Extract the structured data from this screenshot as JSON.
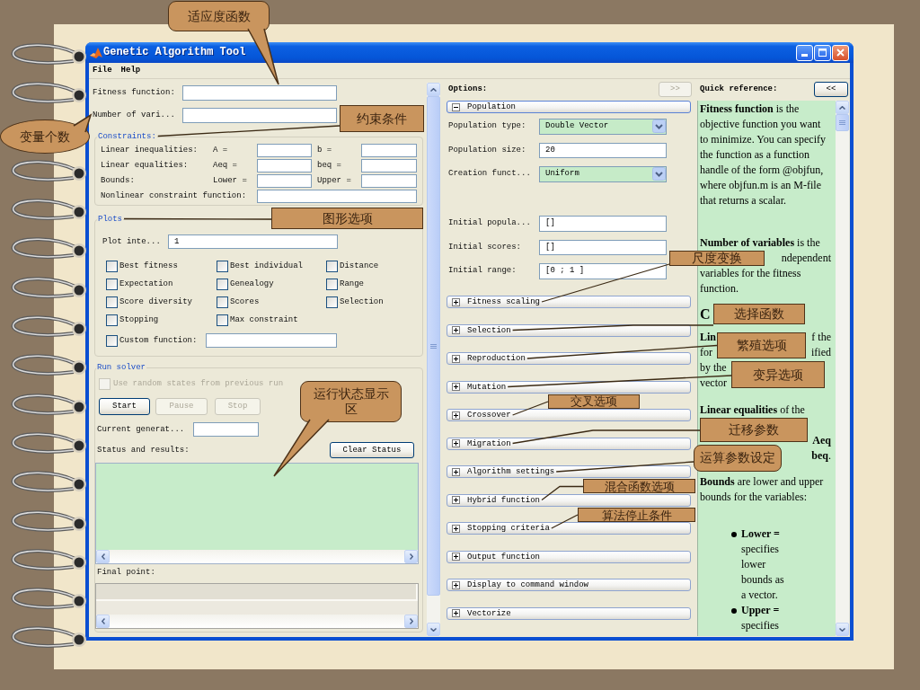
{
  "window": {
    "title": "Genetic Algorithm Tool"
  },
  "menu": [
    {
      "label": "File"
    },
    {
      "label": "Help"
    }
  ],
  "problem": [
    {
      "label": "Fitness function:"
    },
    {
      "label": "Number of vari..."
    }
  ],
  "constraints": {
    "title": "Constraints:",
    "rows": [
      {
        "label": "Linear inequalities:",
        "inputs": [
          "A =",
          "b ="
        ]
      },
      {
        "label": "Linear equalities:",
        "inputs": [
          "Aeq =",
          "beq ="
        ]
      },
      {
        "label": "Bounds:",
        "inputs": [
          "Lower =",
          "Upper ="
        ]
      }
    ],
    "nonlinear": {
      "label": "Nonlinear constraint function:"
    }
  },
  "plots": {
    "title": "Plots",
    "interval": {
      "label": "Plot inte...",
      "value": "1"
    },
    "checkboxes": [
      {
        "label": "Best fitness",
        "checked": false
      },
      {
        "label": "Best individual",
        "checked": false
      },
      {
        "label": "Distance",
        "checked": false
      },
      {
        "label": "Expectation",
        "checked": false
      },
      {
        "label": "Genealogy",
        "checked": false
      },
      {
        "label": "Range",
        "checked": false
      },
      {
        "label": "Score diversity",
        "checked": false
      },
      {
        "label": "Scores",
        "checked": false
      },
      {
        "label": "Selection",
        "checked": false
      },
      {
        "label": "Stopping",
        "checked": false
      },
      {
        "label": "Max constraint",
        "checked": false
      }
    ],
    "custom": {
      "label": "Custom function:",
      "checked": false
    }
  },
  "run_solver": {
    "title": "Run solver",
    "random_states": {
      "label": "Use random states from previous run",
      "checked": false,
      "disabled": true
    },
    "buttons": [
      {
        "label": "Start",
        "disabled": false
      },
      {
        "label": "Pause",
        "disabled": true
      },
      {
        "label": "Stop",
        "disabled": true
      }
    ],
    "current_generation": {
      "label": "Current generat..."
    },
    "status": {
      "label": "Status and results:",
      "clear_button": "Clear Status"
    },
    "final_point": {
      "label": "Final point:"
    }
  },
  "options": {
    "title": "Options:",
    "expand_button": {
      "label": ">>",
      "disabled": true
    },
    "population": {
      "label": "Population",
      "expanded": true,
      "rows": [
        {
          "kind": "dropdown",
          "label": "Population type:",
          "value": "Double Vector"
        },
        {
          "kind": "text",
          "label": "Population size:",
          "value": "20"
        },
        {
          "kind": "dropdown",
          "label": "Creation funct...",
          "value": "Uniform"
        }
      ],
      "initial_rows": [
        {
          "kind": "text",
          "label": "Initial popula...",
          "value": "[]"
        },
        {
          "kind": "text",
          "label": "Initial scores:",
          "value": "[]"
        },
        {
          "kind": "text",
          "label": "Initial range:",
          "value": "[0 ; 1 ]"
        }
      ]
    },
    "sections": [
      {
        "label": "Fitness scaling",
        "expanded": false
      },
      {
        "label": "Selection",
        "expanded": false
      },
      {
        "label": "Reproduction",
        "expanded": false
      },
      {
        "label": "Mutation",
        "expanded": false
      },
      {
        "label": "Crossover",
        "expanded": false
      },
      {
        "label": "Migration",
        "expanded": false
      },
      {
        "label": "Algorithm settings",
        "expanded": false
      },
      {
        "label": "Hybrid function",
        "expanded": false
      },
      {
        "label": "Stopping criteria",
        "expanded": false
      },
      {
        "label": "Output function",
        "expanded": false
      },
      {
        "label": "Display to command window",
        "expanded": false
      },
      {
        "label": "Vectorize",
        "expanded": false
      }
    ]
  },
  "quick_reference": {
    "title": "Quick reference:",
    "collapse_button": "<<",
    "blocks": [
      {
        "kind": "paragraph",
        "text": "**Fitness function** is the objective function you want to minimize. You can specify the function as a function handle of the form @objfun, where objfun.m is an M-file that returns a scalar."
      },
      {
        "kind": "paragraph",
        "text": "**Number of variables** is the"
      },
      {
        "kind": "line",
        "hidden_start": true,
        "parts": [
          {
            "text": "ndependent",
            "bold": false
          }
        ]
      },
      {
        "kind": "paragraph",
        "text": "variables for the fitness function."
      },
      {
        "kind": "heading",
        "text": "C"
      },
      {
        "kind": "line",
        "hidden_start": false,
        "parts": [
          {
            "text": "Lin",
            "bold": true
          },
          {
            "text": "f the",
            "bold": false
          }
        ]
      },
      {
        "kind": "line",
        "hidden_start": false,
        "parts": [
          {
            "text": "for",
            "bold": false
          },
          {
            "text": "ified",
            "bold": false
          }
        ]
      },
      {
        "kind": "line",
        "hidden_start": false,
        "parts": [
          {
            "text": "by the",
            "bold": false
          }
        ]
      },
      {
        "kind": "line",
        "hidden_start": false,
        "parts": [
          {
            "text": "vector",
            "bold": false
          }
        ]
      },
      {
        "kind": "paragraph",
        "text": "**Linear equalities** of the"
      },
      {
        "kind": "line",
        "hidden_start": true,
        "parts": [
          {
            "text": "Aeq",
            "bold": true
          }
        ]
      },
      {
        "kind": "line",
        "hidden_start": true,
        "parts": [
          {
            "text": "**beq**.",
            "bold": false
          }
        ]
      },
      {
        "kind": "paragraph",
        "text": "**Bounds** are lower and upper bounds for the variables:"
      },
      {
        "kind": "bullet",
        "text": "**Lower =** specifies lower bounds as a vector."
      },
      {
        "kind": "bullet",
        "text": "**Upper =** specifies"
      }
    ]
  },
  "callouts": [
    {
      "kind": "bubble",
      "text": "适应度函数"
    },
    {
      "kind": "box",
      "text": "约束条件"
    },
    {
      "kind": "oval",
      "text": "变量个数"
    },
    {
      "kind": "box",
      "text": "图形选项"
    },
    {
      "kind": "box",
      "text": "尺度变换"
    },
    {
      "kind": "box",
      "text": "选择函数"
    },
    {
      "kind": "box",
      "text": "繁殖选项"
    },
    {
      "kind": "box",
      "text": "变异选项"
    },
    {
      "kind": "bubble",
      "text": "运行状态显示区"
    },
    {
      "kind": "box",
      "text": "交叉选项"
    },
    {
      "kind": "box",
      "text": "迁移参数"
    },
    {
      "kind": "rounded_box",
      "text": "运算参数设定"
    },
    {
      "kind": "box",
      "text": "混合函数选项"
    },
    {
      "kind": "box",
      "text": "算法停止条件"
    }
  ]
}
